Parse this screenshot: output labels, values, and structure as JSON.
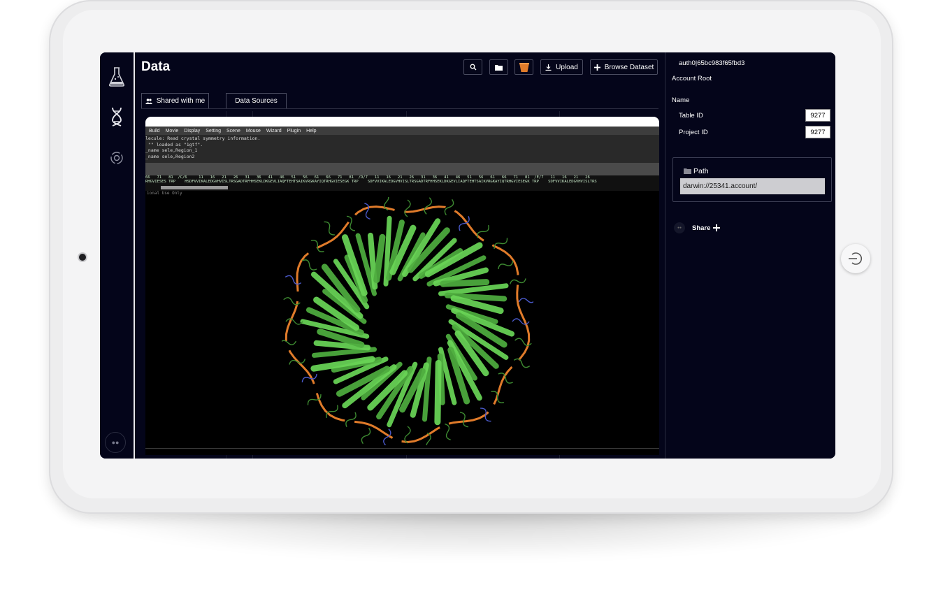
{
  "header": {
    "title": "Data",
    "upload_label": "Upload",
    "browse_label": "Browse Dataset"
  },
  "tabs": [
    {
      "label": "Shared with me"
    },
    {
      "label": "Data Sources"
    }
  ],
  "viewer": {
    "menu": [
      "Build",
      "Movie",
      "Display",
      "Setting",
      "Scene",
      "Mouse",
      "Wizard",
      "Plugin",
      "Help"
    ],
    "console_lines": [
      "lecule: Read crystal symmetry information.",
      " \"\" loaded as \"1gtf\".",
      "_name sele,Region_1",
      "_name sele,Region2"
    ],
    "seq_numbers": "66   71   81  /C/6     11   16   21   26   31   36   41   46   51   56   61   66   71   81  /D/7   11   16   21   26   31   36   41   46   51   56   61   66   71   81  /E/7   11   16   21   26",
    "seq_residues": "RHGVIESES TRP    HSDFVVIKALEDGVHVISLTRSGADTRFHHSEKLDKGEVLIAQFTEHTSAIKVRGKAYIQTRHGVIESEGK TRP    SDFVVIKALEDGVHVISLTRSGADTRFHHSEKLDKGEVLIAQFTEHTSAIKVRGKAYIQTRHGVIESEGK TRP    SDFVVIKALEDGVHVISLTRS",
    "note": "ional Use Only"
  },
  "panel": {
    "auth_id": "auth0|65bc983f65fbd3",
    "account_root": "Account Root",
    "name_label": "Name",
    "table_id_label": "Table ID",
    "table_id_value": "9277",
    "project_id_label": "Project ID",
    "project_id_value": "9277",
    "path_label": "Path",
    "path_value": "darwin://25341.account/",
    "share_label": "Share"
  },
  "colors": {
    "screen_bg": "#04051a",
    "accent_orange": "#e07b2a",
    "helix_green": "#4fae3f"
  },
  "icons": {
    "sidebar": [
      "flask-icon",
      "dna-icon",
      "refresh-gear-icon",
      "avatar-icon"
    ],
    "toolbar": [
      "search-icon",
      "folder-icon",
      "trash-bucket-icon",
      "download-icon",
      "plus-icon"
    ]
  }
}
